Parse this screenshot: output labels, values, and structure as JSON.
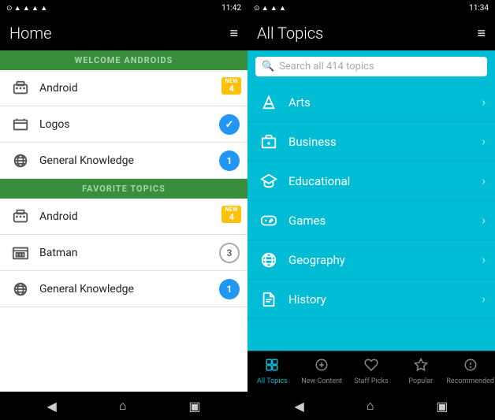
{
  "left": {
    "statusBar": {
      "time": "11:42",
      "icons": "▼ ▲ ▼ ▲ ◀"
    },
    "header": {
      "title": "Home",
      "menuIcon": "≡"
    },
    "welcomeSection": {
      "label": "WELCOME ANDROIDS",
      "items": [
        {
          "id": "android",
          "label": "Android",
          "badge": "4",
          "badgeType": "new"
        },
        {
          "id": "logos",
          "label": "Logos",
          "badge": "✓",
          "badgeType": "blue"
        },
        {
          "id": "general-knowledge-1",
          "label": "General Knowledge",
          "badge": "1",
          "badgeType": "blue"
        }
      ]
    },
    "favoritesSection": {
      "label": "FAVORITE TOPICS",
      "items": [
        {
          "id": "android2",
          "label": "Android",
          "badge": "4",
          "badgeType": "new"
        },
        {
          "id": "batman",
          "label": "Batman",
          "badge": "3",
          "badgeType": "circle"
        },
        {
          "id": "general-knowledge-2",
          "label": "General Knowledge",
          "badge": "1",
          "badgeType": "blue"
        }
      ]
    },
    "navBar": {
      "back": "◀",
      "home": "⌂",
      "recent": "▣"
    }
  },
  "right": {
    "statusBar": {
      "time": "11:34",
      "icons": "▼ ▲ ▼ ▲"
    },
    "header": {
      "title": "All Topics",
      "menuIcon": "≡"
    },
    "searchPlaceholder": "Search all 414 topics",
    "topics": [
      {
        "id": "arts",
        "label": "Arts"
      },
      {
        "id": "business",
        "label": "Business"
      },
      {
        "id": "educational",
        "label": "Educational"
      },
      {
        "id": "games",
        "label": "Games"
      },
      {
        "id": "geography",
        "label": "Geography"
      },
      {
        "id": "history",
        "label": "History"
      }
    ],
    "bottomNav": [
      {
        "id": "all-topics",
        "label": "All Topics",
        "active": true
      },
      {
        "id": "new-content",
        "label": "New Content",
        "active": false
      },
      {
        "id": "staff-picks",
        "label": "Staff Picks",
        "active": false
      },
      {
        "id": "popular",
        "label": "Popular",
        "active": false
      },
      {
        "id": "recommended",
        "label": "Recommended",
        "active": false
      }
    ],
    "navBar": {
      "back": "◀",
      "home": "⌂",
      "recent": "▣"
    }
  }
}
